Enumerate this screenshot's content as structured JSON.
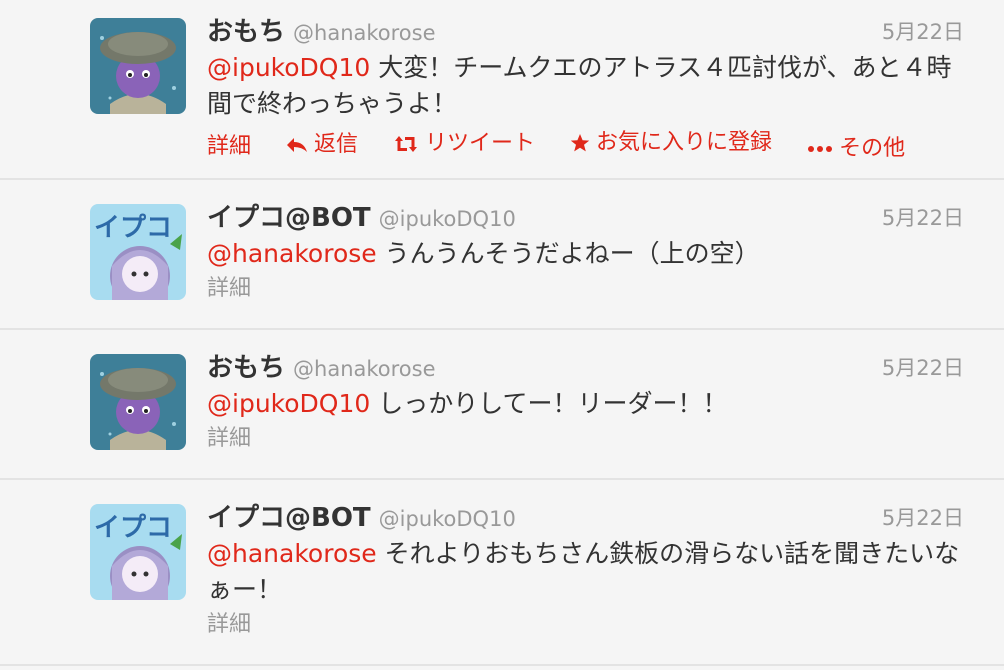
{
  "tweets": [
    {
      "name": "おもち",
      "handle": "@hanakorose",
      "time": "5月22日",
      "mention": "@ipukoDQ10",
      "text": " 大変！チームクエのアトラス４匹討伐が、あと４時間で終わっちゃうよ！",
      "actions": {
        "detail": "詳細",
        "reply": "返信",
        "retweet": "リツイート",
        "favorite": "お気に入りに登録",
        "more": "その他"
      }
    },
    {
      "name": "イプコ@BOT",
      "handle": "@ipukoDQ10",
      "time": "5月22日",
      "mention": "@hanakorose",
      "text": " うんうんそうだよねー（上の空）",
      "detail": "詳細"
    },
    {
      "name": "おもち",
      "handle": "@hanakorose",
      "time": "5月22日",
      "mention": "@ipukoDQ10",
      "text": " しっかりしてー！リーダー！！",
      "detail": "詳細"
    },
    {
      "name": "イプコ@BOT",
      "handle": "@ipukoDQ10",
      "time": "5月22日",
      "mention": "@hanakorose",
      "text": " それよりおもちさん鉄板の滑らない話を聞きたいなぁー！",
      "detail": "詳細"
    }
  ],
  "avatars": {
    "omochi": "omochi-avatar",
    "ipuko": "ipuko-avatar",
    "ipuko_badge": "イプコ"
  },
  "colors": {
    "mention": "#e0281a",
    "muted": "#999999",
    "background": "#f5f5f5"
  }
}
